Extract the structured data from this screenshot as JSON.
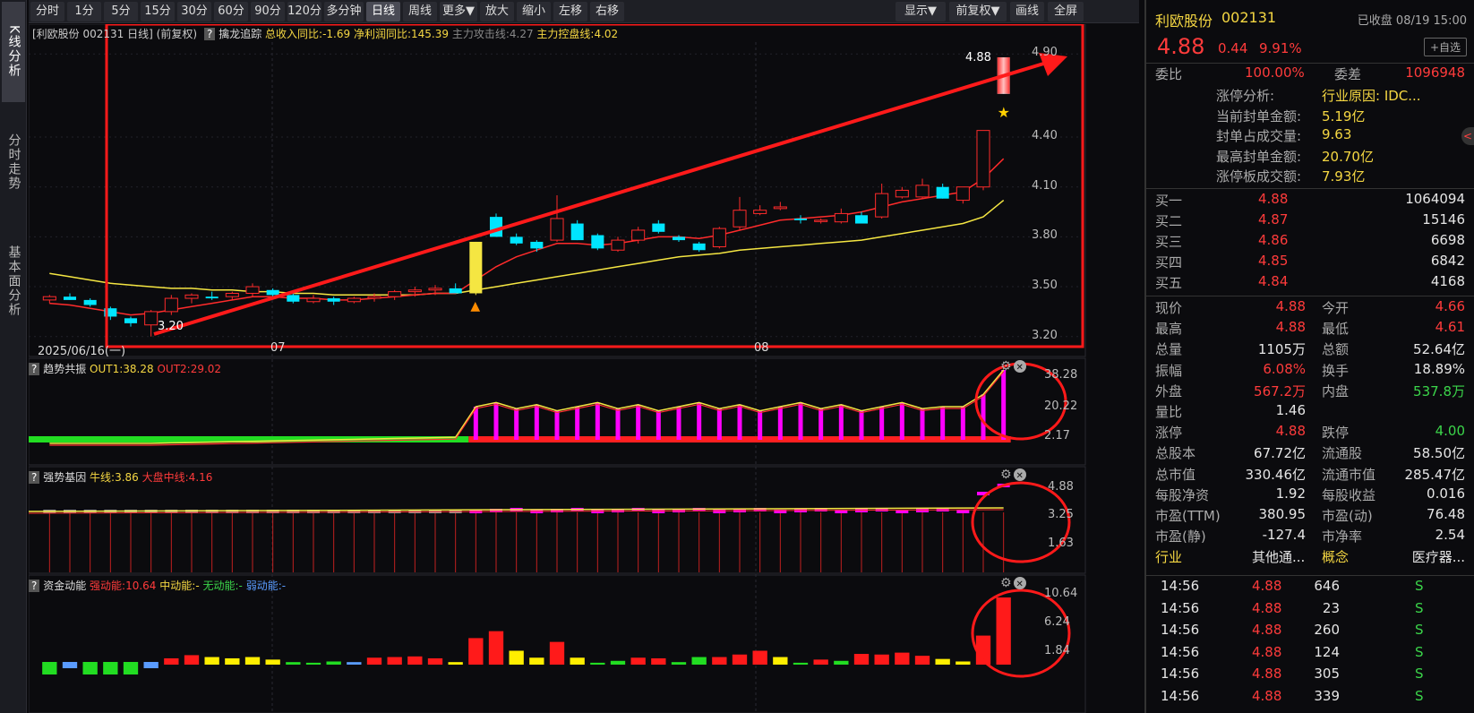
{
  "left_tabs": [
    "K线分析",
    "分时走势",
    "基本面分析"
  ],
  "toolbar": {
    "items": [
      "分时",
      "1分",
      "5分",
      "15分",
      "30分",
      "60分",
      "90分",
      "120分",
      "多分钟",
      "日线",
      "周线",
      "更多▼",
      "放大",
      "缩小",
      "左移",
      "右移"
    ],
    "right": [
      "显示▼",
      "前复权▼",
      "画线",
      "全屏"
    ]
  },
  "main": {
    "title": "[利欧股份 002131 日线]",
    "adj": "(前复权)",
    "ind_name": "擒龙追踪",
    "ind_vals": [
      {
        "t": "总收入同比:-1.69",
        "color": "#f5d742"
      },
      {
        "t": "净利润同比:145.39",
        "color": "#f5d742"
      },
      {
        "t": "主力攻击线:4.27",
        "color": "#888888"
      },
      {
        "t": "主力控盘线:4.02",
        "color": "#f5d742"
      }
    ],
    "yaxis": [
      "4.90",
      "4.40",
      "4.10",
      "3.80",
      "3.50",
      "3.20"
    ],
    "date_label": "2025/06/16(一)",
    "month_labels": [
      "07",
      "08"
    ],
    "high_label": "4.88",
    "low_label": "3.20"
  },
  "chart_data": {
    "type": "candlestick",
    "ylim": [
      3.15,
      4.95
    ],
    "candles": [
      [
        3.42,
        3.45,
        3.4,
        3.44
      ],
      [
        3.44,
        3.46,
        3.42,
        3.42
      ],
      [
        3.42,
        3.43,
        3.38,
        3.39
      ],
      [
        3.37,
        3.38,
        3.3,
        3.32
      ],
      [
        3.31,
        3.32,
        3.26,
        3.28
      ],
      [
        3.27,
        3.36,
        3.2,
        3.35
      ],
      [
        3.35,
        3.45,
        3.33,
        3.43
      ],
      [
        3.43,
        3.46,
        3.4,
        3.45
      ],
      [
        3.44,
        3.47,
        3.42,
        3.43
      ],
      [
        3.44,
        3.47,
        3.42,
        3.46
      ],
      [
        3.46,
        3.52,
        3.44,
        3.5
      ],
      [
        3.48,
        3.49,
        3.44,
        3.45
      ],
      [
        3.45,
        3.46,
        3.4,
        3.41
      ],
      [
        3.41,
        3.45,
        3.4,
        3.43
      ],
      [
        3.43,
        3.44,
        3.39,
        3.41
      ],
      [
        3.41,
        3.44,
        3.4,
        3.43
      ],
      [
        3.43,
        3.46,
        3.41,
        3.44
      ],
      [
        3.44,
        3.48,
        3.42,
        3.47
      ],
      [
        3.47,
        3.5,
        3.44,
        3.48
      ],
      [
        3.48,
        3.51,
        3.45,
        3.49
      ],
      [
        3.49,
        3.52,
        3.46,
        3.46
      ],
      [
        3.46,
        3.77,
        3.45,
        3.77
      ],
      [
        3.92,
        3.94,
        3.8,
        3.8
      ],
      [
        3.8,
        3.82,
        3.75,
        3.76
      ],
      [
        3.77,
        3.78,
        3.71,
        3.73
      ],
      [
        3.78,
        4.05,
        3.77,
        3.91
      ],
      [
        3.88,
        3.9,
        3.78,
        3.78
      ],
      [
        3.81,
        3.82,
        3.72,
        3.73
      ],
      [
        3.72,
        3.8,
        3.71,
        3.78
      ],
      [
        3.78,
        3.86,
        3.76,
        3.84
      ],
      [
        3.88,
        3.9,
        3.82,
        3.83
      ],
      [
        3.8,
        3.81,
        3.77,
        3.78
      ],
      [
        3.76,
        3.77,
        3.71,
        3.72
      ],
      [
        3.74,
        3.86,
        3.73,
        3.85
      ],
      [
        3.86,
        4.04,
        3.84,
        3.96
      ],
      [
        3.94,
        3.99,
        3.93,
        3.96
      ],
      [
        3.97,
        4.01,
        3.96,
        3.98
      ],
      [
        3.91,
        3.93,
        3.88,
        3.9
      ],
      [
        3.9,
        3.91,
        3.88,
        3.9
      ],
      [
        3.89,
        3.97,
        3.88,
        3.94
      ],
      [
        3.93,
        3.95,
        3.88,
        3.88
      ],
      [
        3.92,
        4.12,
        3.91,
        4.06
      ],
      [
        4.04,
        4.1,
        4.03,
        4.08
      ],
      [
        4.04,
        4.15,
        4.03,
        4.11
      ],
      [
        4.1,
        4.12,
        4.03,
        4.03
      ],
      [
        4.02,
        4.1,
        4.0,
        4.1
      ],
      [
        4.1,
        4.44,
        4.08,
        4.44
      ],
      [
        4.88,
        4.88,
        4.66,
        4.66
      ]
    ],
    "ma_yellow": [
      3.58,
      3.56,
      3.54,
      3.52,
      3.51,
      3.5,
      3.49,
      3.49,
      3.48,
      3.48,
      3.47,
      3.47,
      3.46,
      3.46,
      3.45,
      3.45,
      3.45,
      3.45,
      3.45,
      3.46,
      3.46,
      3.48,
      3.5,
      3.52,
      3.54,
      3.56,
      3.58,
      3.6,
      3.62,
      3.64,
      3.66,
      3.68,
      3.69,
      3.7,
      3.72,
      3.73,
      3.74,
      3.75,
      3.76,
      3.77,
      3.78,
      3.8,
      3.82,
      3.84,
      3.86,
      3.88,
      3.92,
      4.02
    ],
    "ma_red": [
      3.4,
      3.39,
      3.37,
      3.35,
      3.33,
      3.34,
      3.36,
      3.38,
      3.4,
      3.42,
      3.44,
      3.44,
      3.43,
      3.43,
      3.42,
      3.42,
      3.43,
      3.44,
      3.45,
      3.46,
      3.46,
      3.54,
      3.62,
      3.68,
      3.72,
      3.76,
      3.76,
      3.75,
      3.76,
      3.78,
      3.8,
      3.8,
      3.79,
      3.81,
      3.84,
      3.87,
      3.9,
      3.91,
      3.92,
      3.93,
      3.95,
      3.98,
      4.01,
      4.03,
      4.05,
      4.07,
      4.15,
      4.27
    ]
  },
  "sub1": {
    "name": "趋势共振",
    "v1": "OUT1:38.28",
    "v2": "OUT2:29.02",
    "yaxis": [
      "38.28",
      "20.22",
      "2.17"
    ]
  },
  "sub2": {
    "name": "强势基因",
    "v1": "牛线:3.86",
    "v2": "大盘中线:4.16",
    "yaxis": [
      "4.88",
      "3.25",
      "1.63"
    ]
  },
  "sub3": {
    "name": "资金动能",
    "v1": "强动能:10.64",
    "v2": "中动能:-",
    "v3": "无动能:-",
    "v4": "弱动能:-",
    "yaxis": [
      "10.64",
      "6.24",
      "1.84"
    ]
  },
  "quote": {
    "name": "利欧股份",
    "code": "002131",
    "status": "已收盘 08/19 15:00",
    "price": "4.88",
    "chg": "0.44",
    "pct": "9.91%",
    "add": "+自选",
    "weibi_l": "委比",
    "weibi": "100.00%",
    "weicha_l": "委差",
    "weicha": "1096948",
    "limit": [
      [
        "涨停分析:",
        "行业原因: IDC..."
      ],
      [
        "当前封单金额:",
        "5.19亿"
      ],
      [
        "封单占成交量:",
        "9.63"
      ],
      [
        "最高封单金额:",
        "20.70亿"
      ],
      [
        "涨停板成交额:",
        "7.93亿"
      ]
    ],
    "book": [
      [
        "买一",
        "4.88",
        "1064094"
      ],
      [
        "买二",
        "4.87",
        "15146"
      ],
      [
        "买三",
        "4.86",
        "6698"
      ],
      [
        "买四",
        "4.85",
        "6842"
      ],
      [
        "买五",
        "4.84",
        "4168"
      ]
    ],
    "stats": [
      [
        "现价",
        "4.88",
        "今开",
        "4.66"
      ],
      [
        "最高",
        "4.88",
        "最低",
        "4.61"
      ],
      [
        "总量",
        "1105万",
        "总额",
        "52.64亿"
      ],
      [
        "振幅",
        "6.08%",
        "换手",
        "18.89%"
      ],
      [
        "外盘",
        "567.2万",
        "内盘",
        "537.8万"
      ],
      [
        "量比",
        "1.46",
        "",
        ""
      ],
      [
        "涨停",
        "4.88",
        "跌停",
        "4.00"
      ],
      [
        "总股本",
        "67.72亿",
        "流通股",
        "58.50亿"
      ],
      [
        "总市值",
        "330.46亿",
        "流通市值",
        "285.47亿"
      ],
      [
        "每股净资",
        "1.92",
        "每股收益",
        "0.016"
      ],
      [
        "市盈(TTM)",
        "380.95",
        "市盈(动)",
        "76.48"
      ],
      [
        "市盈(静)",
        "-127.4",
        "市净率",
        "2.54"
      ],
      [
        "行业",
        "其他通...",
        "概念",
        "医疗器..."
      ]
    ],
    "ticks": [
      [
        "14:56",
        "4.88",
        "646",
        "S"
      ],
      [
        "14:56",
        "4.88",
        "23",
        "S"
      ],
      [
        "14:56",
        "4.88",
        "260",
        "S"
      ],
      [
        "14:56",
        "4.88",
        "124",
        "S"
      ],
      [
        "14:56",
        "4.88",
        "305",
        "S"
      ],
      [
        "14:56",
        "4.88",
        "339",
        "S"
      ]
    ]
  },
  "colors": {
    "up": "#ff2b2b",
    "down": "#00e5ff",
    "ma_yellow": "#f5e642",
    "annot": "#ff1a1a",
    "magenta": "#ff00ff",
    "lime": "#22dd22"
  }
}
